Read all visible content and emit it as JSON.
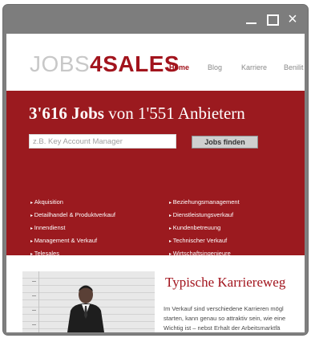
{
  "window": {
    "controls": {
      "close_glyph": "×"
    }
  },
  "header": {
    "logo": {
      "part1": "JOBS",
      "part2": "4",
      "part3": "SALES"
    },
    "nav": [
      "Home",
      "Blog",
      "Karriere",
      "Benilit"
    ]
  },
  "hero": {
    "title_bold": "3'616 Jobs",
    "title_rest": " von 1'551 Anbietern",
    "search": {
      "placeholder": "z.B. Key Account Manager",
      "button": "Jobs finden"
    },
    "categories_left": [
      "Akquisition",
      "Detailhandel & Produktverkauf",
      "Innendienst",
      "Management & Verkauf",
      "Telesales"
    ],
    "categories_right": [
      "Beziehungsmanagement",
      "Dienstleistungsverkauf",
      "Kundenbetreuung",
      "Technischer Verkauf",
      "Wirtschaftsingenieure"
    ]
  },
  "content": {
    "title": "Typische Karriereweg",
    "lines": [
      "Im Verkauf sind verschiedene Karrieren mögl",
      "starten, kann genau so attraktiv sein, wie eine",
      "Wichtig ist – nebst Erhalt der Arbeitsmarktfä"
    ]
  },
  "colors": {
    "brand_red": "#9b1a1f",
    "accent_red": "#a2141d",
    "chrome_gray": "#7d7d7d"
  }
}
